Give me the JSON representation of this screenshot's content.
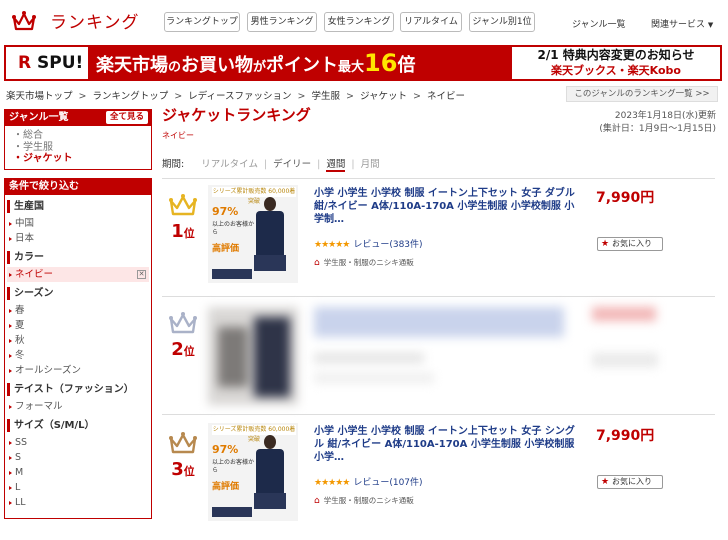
{
  "header": {
    "logo_text": "ランキング",
    "nav_buttons": [
      "ランキングトップ",
      "男性ランキング",
      "女性ランキング",
      "リアルタイム",
      "ジャンル別1位"
    ],
    "genre_list_link": "ジャンル一覧",
    "related_services": "関連サービス"
  },
  "banner": {
    "spu_r": "R",
    "spu_text": "SPU!",
    "main_text_a": "楽天市場",
    "main_text_b": "の",
    "main_text_c": "お買い物",
    "main_text_d": "が",
    "main_text_e": "ポイント",
    "main_text_f": "最大",
    "main_text_big": "16",
    "main_text_g": "倍",
    "right_line1": "2/1 特典内容変更のお知らせ",
    "right_line2": "楽天ブックス・楽天Kobo",
    "accent_color": "#bf0000"
  },
  "breadcrumb": [
    "楽天市場トップ",
    "ランキングトップ",
    "レディースファッション",
    "学生服",
    "ジャケット",
    "ネイビー"
  ],
  "genre_ranking_link": "このジャンルのランキング一覧 >>",
  "sidebar": {
    "genre_title": "ジャンル一覧",
    "show_all": "全て見る",
    "genres": [
      "総合",
      "学生服",
      "ジャケット"
    ],
    "filter_title": "条件で絞り込む",
    "sections": [
      {
        "title": "生産国",
        "items": [
          "中国",
          "日本"
        ]
      },
      {
        "title": "カラー",
        "items": [
          "ネイビー"
        ]
      },
      {
        "title": "シーズン",
        "items": [
          "春",
          "夏",
          "秋",
          "冬",
          "オールシーズン"
        ]
      },
      {
        "title": "テイスト（ファッション）",
        "items": [
          "フォーマル"
        ]
      },
      {
        "title": "サイズ（S/M/L）",
        "items": [
          "SS",
          "S",
          "M",
          "L",
          "LL"
        ]
      }
    ]
  },
  "main": {
    "title": "ジャケットランキング",
    "subtitle": "ネイビー",
    "updated": "2023年1月18日(水)更新",
    "period_range": "(集計日：1月9日〜1月15日)",
    "period_label": "期間:",
    "periods": [
      "リアルタイム",
      "デイリー",
      "週間",
      "月間"
    ],
    "active_period": "週間"
  },
  "rankings": [
    {
      "rank": "1",
      "rank_suffix": "位",
      "crown_color": "#e6b422",
      "title": "小学 小学生 小学校 制服 イートン上下セット 女子 ダブル 紺/ネイビー A体/110A-170A 小学生制服 小学校制服 小学制…",
      "price": "7,990円",
      "stars": "★★★★★",
      "review": "レビュー(383件)",
      "shop": "学生服・制服のニシキ通販",
      "fav": "お気に入り",
      "badge_top": "シリーズ累計販売数 60,000着突破",
      "badge_pct": "97%",
      "badge_text": "以上のお客様から",
      "badge_eval": "高評価"
    },
    {
      "rank": "2",
      "rank_suffix": "位",
      "crown_color": "#aab2c8"
    },
    {
      "rank": "3",
      "rank_suffix": "位",
      "crown_color": "#b7894f",
      "title": "小学 小学生 小学校 制服 イートン上下セット 女子 シングル 紺/ネイビー A体/110A-170A 小学生制服 小学校制服 小学…",
      "price": "7,990円",
      "stars": "★★★★★",
      "review": "レビュー(107件)",
      "shop": "学生服・制服のニシキ通販",
      "fav": "お気に入り",
      "badge_top": "シリーズ累計販売数 60,000着突破",
      "badge_pct": "97%",
      "badge_text": "以上のお客様から",
      "badge_eval": "高評価"
    }
  ]
}
